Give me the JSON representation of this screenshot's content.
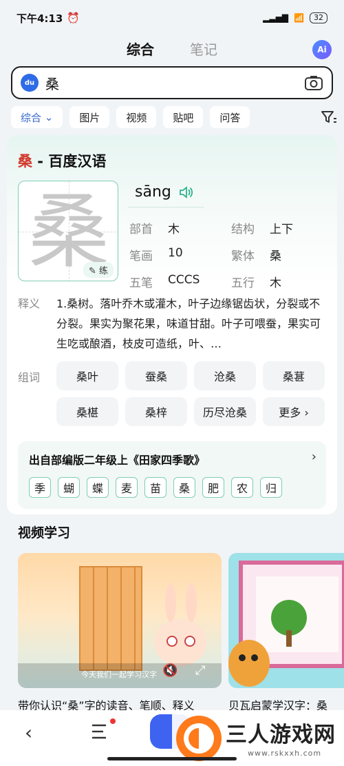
{
  "status_bar": {
    "time": "下午4:13",
    "battery": "32"
  },
  "top_tabs": [
    {
      "label": "综合"
    },
    {
      "label": "笔记"
    }
  ],
  "ai_button": "Ai",
  "search": {
    "query": "桑"
  },
  "filters": [
    "综合",
    "图片",
    "视频",
    "贴吧",
    "问答"
  ],
  "card": {
    "title_char": "桑",
    "title_rest": " - 百度汉语",
    "character": "桑",
    "practice_label": "练",
    "pinyin": "sāng",
    "attributes": [
      {
        "k": "部首",
        "v": "木"
      },
      {
        "k": "结构",
        "v": "上下"
      },
      {
        "k": "笔画",
        "v": "10"
      },
      {
        "k": "繁体",
        "v": "桑"
      },
      {
        "k": "五笔",
        "v": "CCCS"
      },
      {
        "k": "五行",
        "v": "木"
      }
    ],
    "meaning_label": "释义",
    "meaning": "1.桑树。落叶乔木或灌木，叶子边缘锯齿状，分裂或不分裂。果实为聚花果，味道甘甜。叶子可喂蚕，果实可生吃或酿酒，枝皮可造纸，叶、…",
    "words_label": "组词",
    "words": [
      "桑叶",
      "蚕桑",
      "沧桑",
      "桑葚",
      "桑椹",
      "桑梓",
      "历尽沧桑",
      "更多 ›"
    ],
    "source_title": "出自部编版二年级上《田家四季歌》",
    "source_chars": [
      "季",
      "蝴",
      "蝶",
      "麦",
      "苗",
      "桑",
      "肥",
      "农",
      "归"
    ]
  },
  "videos": {
    "heading": "视频学习",
    "items": [
      {
        "title": "带你认识“桑”字的读音、笔顺、释义",
        "caption": "今天我们一起学习汉字"
      },
      {
        "title": "贝瓦启蒙学汉字：桑"
      }
    ]
  },
  "watermark": {
    "name": "三人游戏网",
    "url": "www.rskxxh.com"
  }
}
